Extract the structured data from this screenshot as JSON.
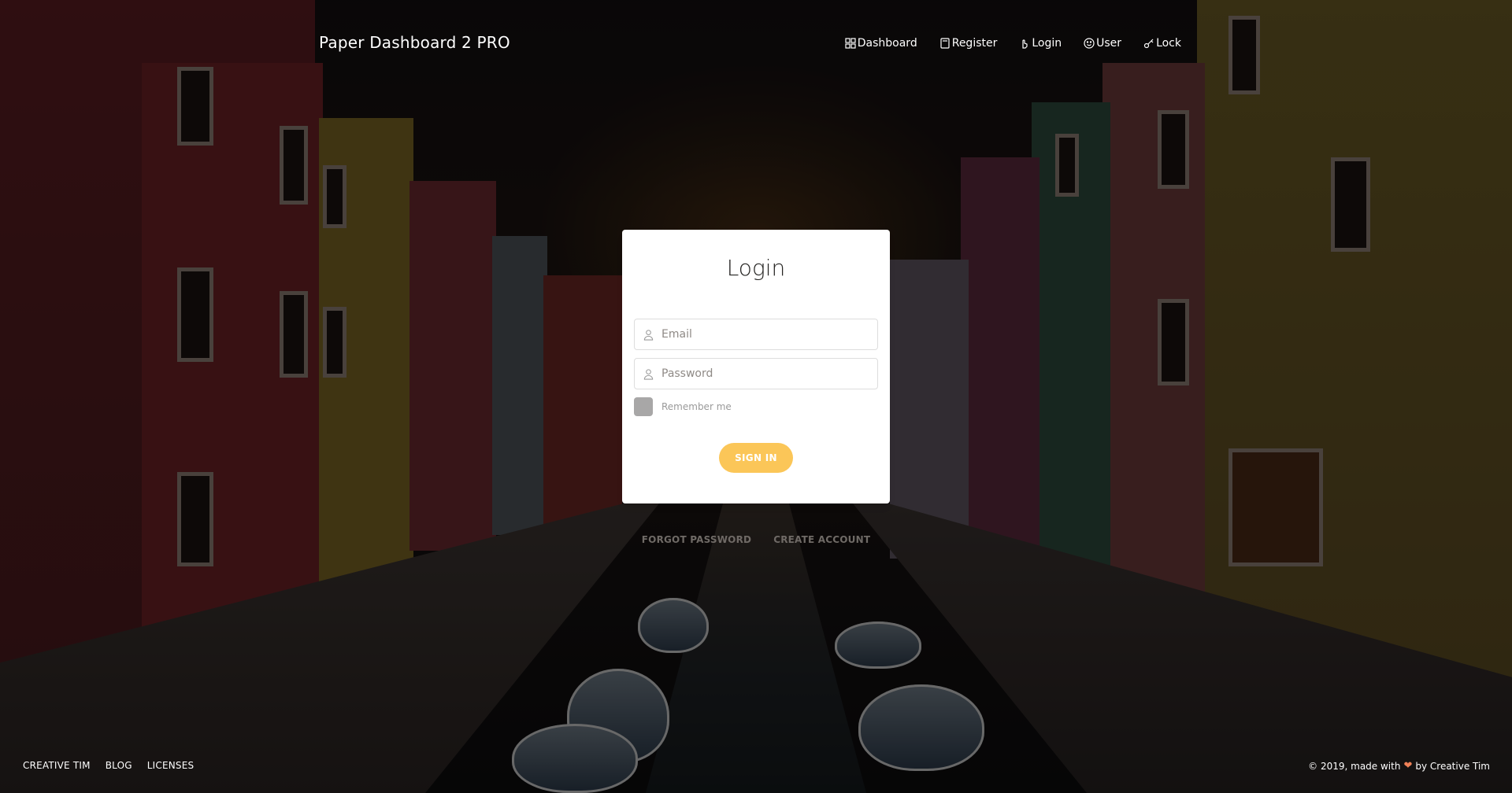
{
  "navbar": {
    "brand": "Paper Dashboard 2 PRO",
    "items": [
      {
        "label": "Dashboard",
        "icon": "dashboard-grid-icon"
      },
      {
        "label": "Register",
        "icon": "book-icon"
      },
      {
        "label": "Login",
        "icon": "tap-hand-icon"
      },
      {
        "label": "User",
        "icon": "user-face-icon"
      },
      {
        "label": "Lock",
        "icon": "key-icon"
      }
    ]
  },
  "login_card": {
    "title": "Login",
    "email": {
      "placeholder": "Email",
      "value": "",
      "icon": "user-icon"
    },
    "password": {
      "placeholder": "Password",
      "value": "",
      "icon": "user-icon"
    },
    "remember_label": "Remember me",
    "remember_checked": false,
    "submit_label": "SIGN IN"
  },
  "below_card_links": {
    "forgot": "FORGOT PASSWORD",
    "create": "CREATE ACCOUNT"
  },
  "footer": {
    "links": [
      "CREATIVE TIM",
      "BLOG",
      "LICENSES"
    ],
    "copyright_prefix": "© 2019, made with",
    "copyright_suffix": "by Creative Tim",
    "heart_icon": "heart-icon"
  },
  "colors": {
    "accent_button": "#fbc658",
    "heart": "#ef8157"
  }
}
